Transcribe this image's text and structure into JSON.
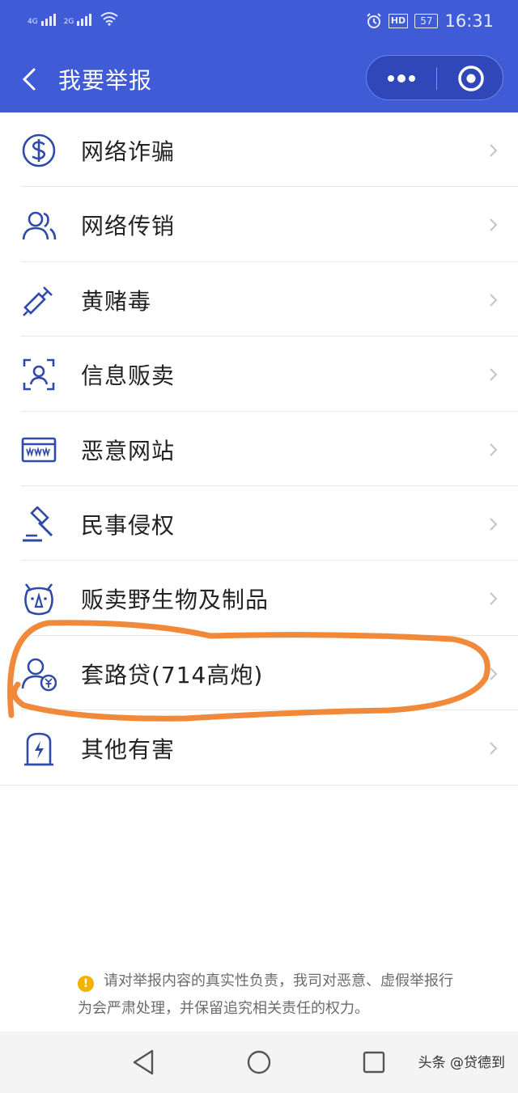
{
  "status_bar": {
    "left": [
      {
        "net": "4G"
      },
      {
        "net": "2G"
      }
    ],
    "hd": "HD",
    "battery": "57",
    "time": "16:31"
  },
  "header": {
    "title": "我要举报",
    "back_icon": "chevron-left-icon",
    "more_icon": "more-dots-icon",
    "close_icon": "target-circle-icon",
    "bg_color": "#3f5bd6"
  },
  "report_items": [
    {
      "label": "网络诈骗",
      "icon": "dollar-coin-icon"
    },
    {
      "label": "网络传销",
      "icon": "users-icon"
    },
    {
      "label": "黄赌毒",
      "icon": "syringe-icon"
    },
    {
      "label": "信息贩卖",
      "icon": "face-scan-icon"
    },
    {
      "label": "恶意网站",
      "icon": "www-card-icon"
    },
    {
      "label": "民事侵权",
      "icon": "gavel-icon"
    },
    {
      "label": "贩卖野生物及制品",
      "icon": "rhino-icon"
    },
    {
      "label": "套路贷(714高炮)",
      "icon": "user-yuan-icon"
    },
    {
      "label": "其他有害",
      "icon": "lightning-shield-icon"
    }
  ],
  "notice": {
    "text": "请对举报内容的真实性负责，我司对恶意、虚假举报行为会严肃处理，并保留追究相关责任的权力。",
    "icon": "warning-icon"
  },
  "nav": {
    "back_icon": "triangle-back-icon",
    "home_icon": "circle-home-icon",
    "recent_icon": "square-recent-icon"
  },
  "watermark": "头条 @贷德到",
  "colors": {
    "accent": "#3f5bd6",
    "icon": "#2f4aa8",
    "annotation": "#f0893a"
  }
}
